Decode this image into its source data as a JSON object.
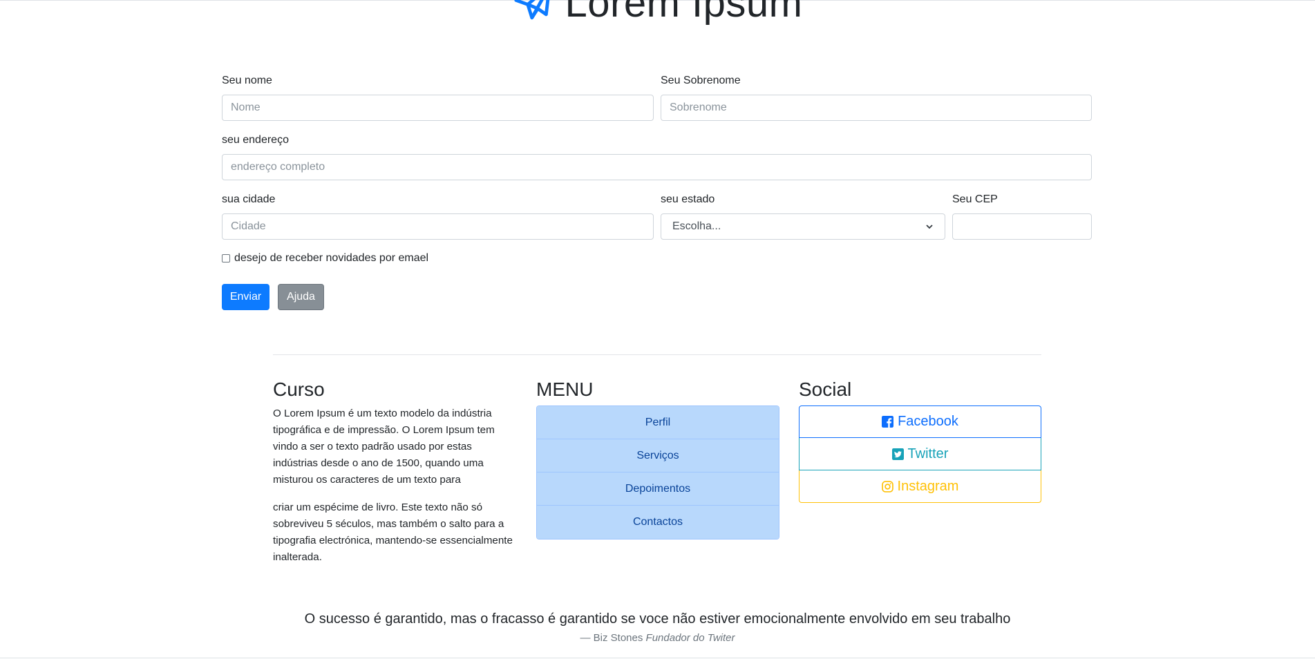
{
  "header": {
    "title": "Lorem Ipsum",
    "logo_icon": "paper-plane-icon",
    "accent_color": "#0d7bff"
  },
  "form": {
    "first_name": {
      "label": "Seu nome",
      "placeholder": "Nome"
    },
    "last_name": {
      "label": "Seu Sobrenome",
      "placeholder": "Sobrenome"
    },
    "address": {
      "label": "seu endereço",
      "placeholder": "endereço completo"
    },
    "city": {
      "label": "sua cidade",
      "placeholder": "Cidade"
    },
    "state": {
      "label": "seu estado",
      "selected": "Escolha..."
    },
    "cep": {
      "label": "Seu CEP",
      "value": ""
    },
    "newsletter": {
      "label": "desejo de receber novidades por emael",
      "checked": false
    },
    "submit_label": "Enviar",
    "help_label": "Ajuda"
  },
  "curso": {
    "title": "Curso",
    "paragraph1": "O Lorem Ipsum é um texto modelo da indústria tipográfica e de impressão. O Lorem Ipsum tem vindo a ser o texto padrão usado por estas indústrias desde o ano de 1500, quando uma misturou os caracteres de um texto para",
    "paragraph2": "criar um espécime de livro. Este texto não só sobreviveu 5 séculos, mas também o salto para a tipografia electrónica, mantendo-se essencialmente inalterada."
  },
  "menu": {
    "title": "MENU",
    "items": [
      {
        "label": "Perfil"
      },
      {
        "label": "Serviços"
      },
      {
        "label": "Depoimentos"
      },
      {
        "label": "Contactos"
      }
    ]
  },
  "social": {
    "title": "Social",
    "links": [
      {
        "label": "Facebook",
        "icon": "facebook-icon",
        "color": "#0d6efd"
      },
      {
        "label": "Twitter",
        "icon": "twitter-icon",
        "color": "#17a2b8"
      },
      {
        "label": "Instagram",
        "icon": "instagram-icon",
        "color": "#ffc107"
      }
    ]
  },
  "quote": {
    "text": "O sucesso é garantido, mas o fracasso é garantido se voce não estiver emocionalmente envolvido em seu trabalho",
    "author": "— Biz Stones",
    "source": "Fundador do Twiter"
  }
}
